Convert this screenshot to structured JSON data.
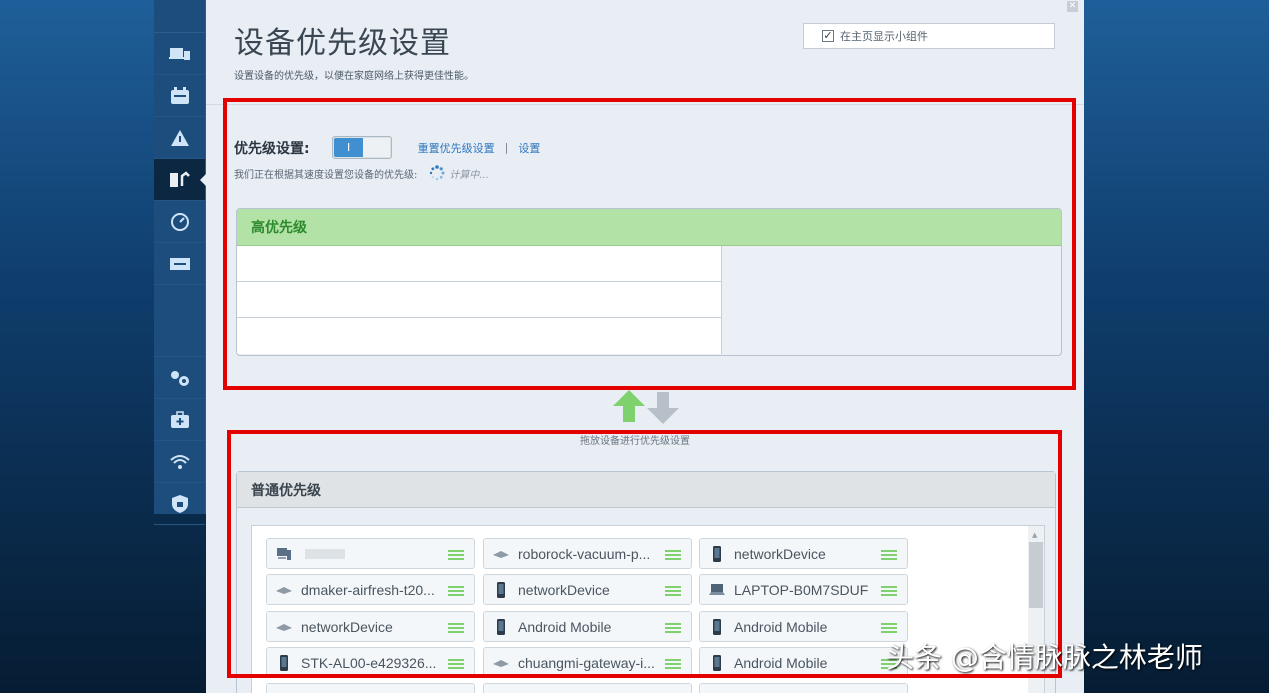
{
  "header": {
    "title": "设备优先级设置",
    "subtitle": "设置设备的优先级，以便在家庭网络上获得更佳性能。",
    "widget_label": "在主页显示小组件",
    "widget_checked": true
  },
  "priority": {
    "label": "优先级设置:",
    "toggle_text": "I",
    "reset_link": "重置优先级设置",
    "separator": "|",
    "settings_link": "设置",
    "status_text": "我们正在根据其速度设置您设备的优先级:",
    "calculating_text": "计算中..."
  },
  "high_priority": {
    "title": "高优先级",
    "header_color": "#b2e2a5"
  },
  "drag_hint": "拖放设备进行优先级设置",
  "normal_priority": {
    "title": "普通优先级",
    "devices": [
      {
        "name": "",
        "icon": "computer-icon",
        "name_blurred": true
      },
      {
        "name": "roborock-vacuum-p...",
        "icon": "router-icon"
      },
      {
        "name": "networkDevice",
        "icon": "phone-icon"
      },
      {
        "name": "dmaker-airfresh-t20...",
        "icon": "router-icon"
      },
      {
        "name": "networkDevice",
        "icon": "phone-icon"
      },
      {
        "name": "LAPTOP-B0M7SDUF",
        "icon": "laptop-icon"
      },
      {
        "name": "networkDevice",
        "icon": "router-icon"
      },
      {
        "name": "Android Mobile",
        "icon": "phone-icon"
      },
      {
        "name": "Android Mobile",
        "icon": "phone-icon"
      },
      {
        "name": "STK-AL00-e429326...",
        "icon": "phone-icon"
      },
      {
        "name": "chuangmi-gateway-i...",
        "icon": "router-icon"
      },
      {
        "name": "Android Mobile",
        "icon": "phone-icon"
      }
    ]
  },
  "sidebar": {
    "items": [
      "devices-icon",
      "guest-access-icon",
      "parental-controls-icon",
      "media-prioritization-icon",
      "speed-test-icon",
      "external-storage-icon",
      "connectivity-icon",
      "troubleshooting-icon",
      "wireless-icon",
      "security-icon"
    ],
    "active": "media-prioritization-icon"
  },
  "watermark": "头条 @含情脉脉之林老师",
  "colors": {
    "accent": "#2f77c0",
    "highlight_red": "#e50000",
    "grip_green": "#7fd16e"
  }
}
